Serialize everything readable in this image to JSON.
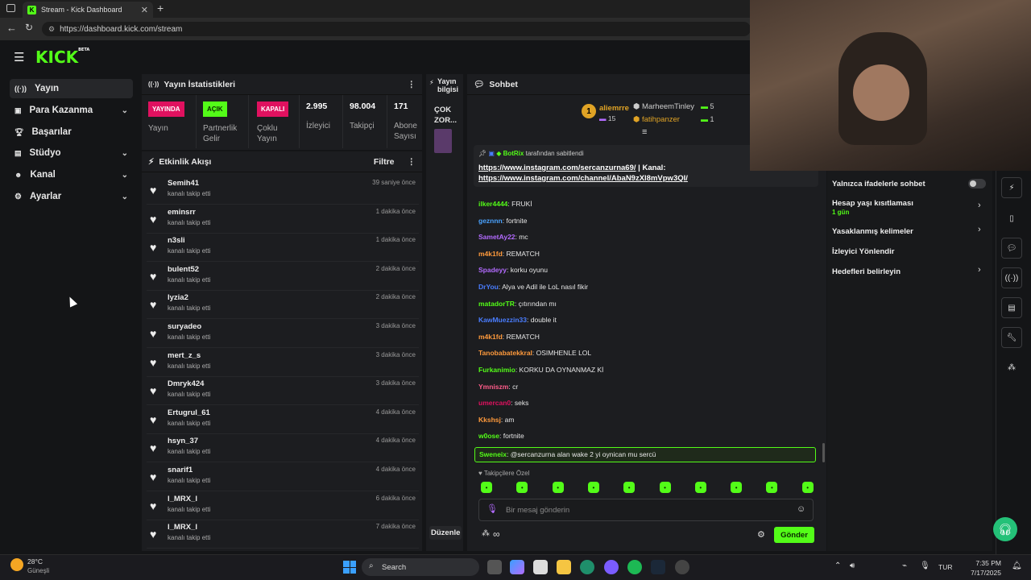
{
  "browser": {
    "tab_title": "Stream - Kick Dashboard",
    "url": "https://dashboard.kick.com/stream"
  },
  "brand": {
    "logo": "KICK",
    "logo_sup": "BETA",
    "accent": "#53fc18"
  },
  "sidebar": {
    "items": [
      {
        "label": "Yayın",
        "icon": "broadcast-icon",
        "chevron": false
      },
      {
        "label": "Para Kazanma",
        "icon": "wallet-icon",
        "chevron": true
      },
      {
        "label": "Başarılar",
        "icon": "trophy-icon",
        "chevron": false
      },
      {
        "label": "Stüdyo",
        "icon": "studio-icon",
        "chevron": true
      },
      {
        "label": "Kanal",
        "icon": "users-icon",
        "chevron": true
      },
      {
        "label": "Ayarlar",
        "icon": "gear-icon",
        "chevron": true
      }
    ]
  },
  "stats": {
    "title": "Yayın İstatistikleri",
    "items": [
      {
        "badge": "YAYINDA",
        "label": "Yayın"
      },
      {
        "badge": "AÇIK",
        "label": "Partnerlik Gelir"
      },
      {
        "badge": "KAPALI",
        "label": "Çoklu Yayın"
      },
      {
        "value": "2.995",
        "label": "İzleyici"
      },
      {
        "value": "98.004",
        "label": "Takipçi"
      },
      {
        "value": "171",
        "label": "Abone Sayısı"
      }
    ]
  },
  "activity": {
    "title": "Etkinlik Akışı",
    "filter": "Filtre",
    "items": [
      {
        "name": "Semih41",
        "action": "kanalı takip etti",
        "time": "39 saniye önce"
      },
      {
        "name": "eminsrr",
        "action": "kanalı takip etti",
        "time": "1 dakika önce"
      },
      {
        "name": "n3sli",
        "action": "kanalı takip etti",
        "time": "1 dakika önce"
      },
      {
        "name": "bulent52",
        "action": "kanalı takip etti",
        "time": "2 dakika önce"
      },
      {
        "name": "lyzia2",
        "action": "kanalı takip etti",
        "time": "2 dakika önce"
      },
      {
        "name": "suryadeo",
        "action": "kanalı takip etti",
        "time": "3 dakika önce"
      },
      {
        "name": "mert_z_s",
        "action": "kanalı takip etti",
        "time": "3 dakika önce"
      },
      {
        "name": "Dmryk424",
        "action": "kanalı takip etti",
        "time": "3 dakika önce"
      },
      {
        "name": "Ertugrul_61",
        "action": "kanalı takip etti",
        "time": "4 dakika önce"
      },
      {
        "name": "hsyn_37",
        "action": "kanalı takip etti",
        "time": "4 dakika önce"
      },
      {
        "name": "snarif1",
        "action": "kanalı takip etti",
        "time": "4 dakika önce"
      },
      {
        "name": "l_MRX_l",
        "action": "kanalı takip etti",
        "time": "6 dakika önce"
      },
      {
        "name": "l_MRX_l",
        "action": "kanalı takip etti",
        "time": "7 dakika önce"
      }
    ]
  },
  "stream_info": {
    "title": "Yayın bilgisi",
    "snippet": "ÇOK ZOR...",
    "edit": "Düzenle"
  },
  "chat": {
    "title": "Sohbet",
    "leaderboard": [
      {
        "name": "aliemrre",
        "count": "15",
        "rank": "1"
      },
      {
        "name": "MarheemTinley",
        "count": "5"
      },
      {
        "name": "fatihpanzer",
        "count": "1"
      }
    ],
    "pinned": {
      "by": "BotRix",
      "by_suffix": "tarafından sabitlendi",
      "line1": "https://www.instagram.com/sercanzurna69/",
      "line1_suffix": " | Kanal:",
      "line2": "https://www.instagram.com/channel/AbaN9zXl8mVpw3QI/"
    },
    "messages": [
      {
        "user": "ilker4444",
        "text": "FRUKİ",
        "color": "#53fc18"
      },
      {
        "user": "geznnn",
        "text": "fortnite",
        "color": "#4aa3ff"
      },
      {
        "user": "SametAy22",
        "text": "mc",
        "color": "#b36bff"
      },
      {
        "user": "m4k1fd",
        "text": "REMATCH",
        "color": "#ff9a3c"
      },
      {
        "user": "Spadeyy",
        "text": "korku oyunu",
        "color": "#b36bff"
      },
      {
        "user": "DrYou",
        "text": "Alya ve Adil ile LoL nasıl fikir",
        "color": "#4a7dff"
      },
      {
        "user": "matadorTR",
        "text": "çıtırından mı",
        "color": "#53fc18"
      },
      {
        "user": "KawMuezzin33",
        "text": "double it",
        "color": "#4a7dff"
      },
      {
        "user": "m4k1fd",
        "text": "REMATCH",
        "color": "#ff9a3c"
      },
      {
        "user": "Tanobabatekkral",
        "text": "OSIMHENLE LOL",
        "color": "#ff9a3c"
      },
      {
        "user": "Furkanimio",
        "text": "KORKU DA OYNANMAZ Kİ",
        "color": "#53fc18"
      },
      {
        "user": "Ymniszm",
        "text": "cr",
        "color": "#ff5c8a"
      },
      {
        "user": "umercan0",
        "text": "seks",
        "color": "#e0115f"
      },
      {
        "user": "Kkshsj",
        "text": "am",
        "color": "#ff9a3c"
      },
      {
        "user": "w0ose",
        "text": "fortnite",
        "color": "#53fc18"
      }
    ],
    "highlight": {
      "user": "Sweneix",
      "text": "@sercanzurna alan wake 2 yi oynican mu sercü"
    },
    "follower_only": "Takipçilere Özel",
    "input_placeholder": "Bir mesaj gönderin",
    "send": "Gönder",
    "infinity": "∞"
  },
  "chat_settings": {
    "items": [
      {
        "label": "Yalnızca ifadelerle sohbet",
        "control": "toggle",
        "on": false
      },
      {
        "label": "Hesap yaşı kısıtlaması",
        "sub": "1 gün",
        "control": "chevron"
      },
      {
        "label": "Yasaklanmış kelimeler",
        "control": "chevron"
      },
      {
        "label": "İzleyici Yönlendir",
        "control": "none"
      },
      {
        "label": "Hedefleri belirleyin",
        "control": "chevron"
      }
    ]
  },
  "taskbar": {
    "weather_temp": "28°C",
    "weather_desc": "Güneşli",
    "search": "Search",
    "lang": "TUR",
    "time": "7:35 PM",
    "date": "7/17/2025"
  }
}
